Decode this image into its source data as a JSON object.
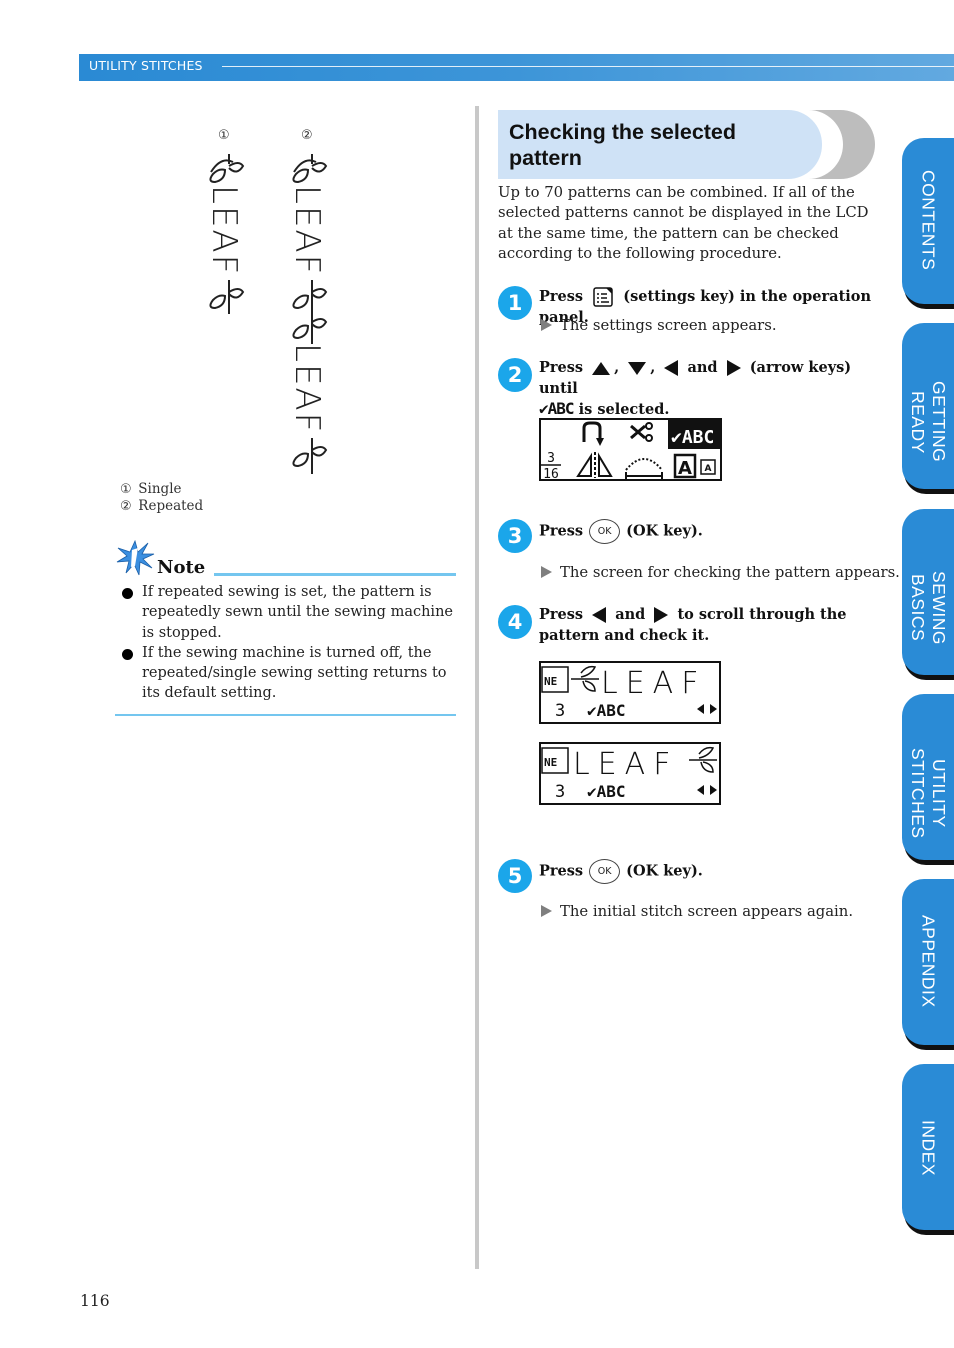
{
  "header": {
    "section_label": "UTILITY STITCHES"
  },
  "figure": {
    "markers": [
      "①",
      "②"
    ],
    "single_text": "LEAF",
    "repeated_text": [
      "LEAF",
      "LEAF"
    ],
    "legend": [
      {
        "marker": "①",
        "label": "Single"
      },
      {
        "marker": "②",
        "label": "Repeated"
      }
    ]
  },
  "note": {
    "title": "Note",
    "items": [
      "If repeated sewing is set, the pattern is repeatedly sewn until the sewing machine is stopped.",
      "If the sewing machine is turned off, the repeated/single sewing setting returns to its default setting."
    ]
  },
  "section": {
    "title": "Checking the selected pattern",
    "intro": "Up to 70 patterns can be combined. If all of the selected patterns cannot be displayed in the LCD at the same time, the pattern can be checked according to the following procedure."
  },
  "steps": [
    {
      "number": "1",
      "press": "Press",
      "icon": "settings-key-icon",
      "text_after": "(settings key) in the operation panel.",
      "result": "The settings screen appears."
    },
    {
      "number": "2",
      "press": "Press",
      "sep1": ",",
      "sep2": ",",
      "and": "and",
      "text_after": "(arrow keys) until",
      "selected_glyph": "✔ABC",
      "text_end": "is selected."
    },
    {
      "number": "3",
      "press": "Press",
      "key": "OK",
      "text_after": "(OK key).",
      "result": "The screen for checking the pattern appears."
    },
    {
      "number": "4",
      "press": "Press",
      "and": "and",
      "text_after": "to scroll through the pattern and check it."
    },
    {
      "number": "5",
      "press": "Press",
      "key": "OK",
      "text_after": "(OK key).",
      "result": "The initial stitch screen appears again."
    }
  ],
  "lcd_settings": {
    "fraction_top": "3",
    "fraction_bottom": "16",
    "selected_item": "✔ABC"
  },
  "lcd_patterns": [
    {
      "text": "LEAF",
      "leaf_position": "before",
      "count": "3",
      "mode": "✔ABC"
    },
    {
      "text": "LEAF",
      "leaf_position": "after",
      "count": "3",
      "mode": "✔ABC"
    }
  ],
  "side_tabs": [
    {
      "label": "CONTENTS"
    },
    {
      "label": "GETTING READY"
    },
    {
      "label": "SEWING BASICS"
    },
    {
      "label": "UTILITY STITCHES"
    },
    {
      "label": "APPENDIX"
    },
    {
      "label": "INDEX"
    }
  ],
  "page_number": "116"
}
